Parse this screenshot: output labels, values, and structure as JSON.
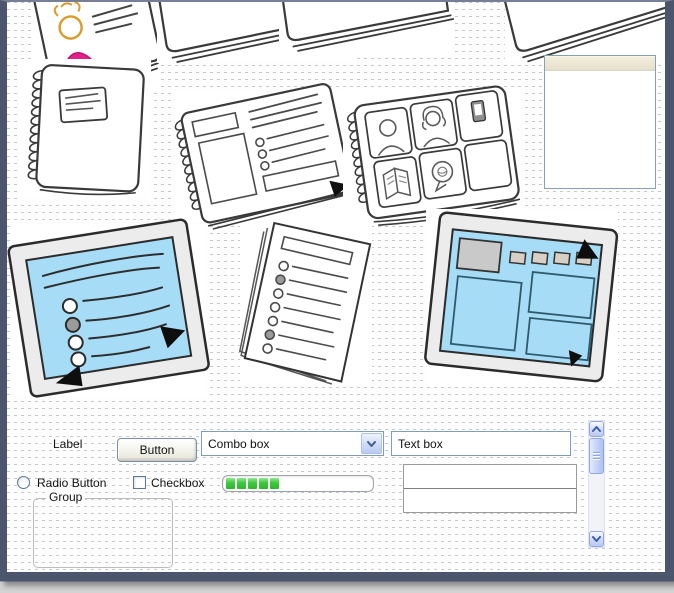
{
  "window": {
    "frame_color": "#4b556b",
    "desktop_color": "#d3d3d3"
  },
  "canvas": {
    "background": "#fdfdfe",
    "grid_dot_color": "#c6c8ce"
  },
  "gallery": {
    "items": [
      {
        "icon": "person-card-sketch"
      },
      {
        "icon": "book-bottom-sketch-1"
      },
      {
        "icon": "book-bottom-sketch-2"
      },
      {
        "icon": "book-bottom-sketch-3"
      },
      {
        "icon": "spiral-notebook-sketch"
      },
      {
        "icon": "wireframe-sketchbook-sketch"
      },
      {
        "icon": "photo-album-sketch"
      },
      {
        "icon": "blank-panel-with-header"
      },
      {
        "icon": "blue-slide-tablet-sketch"
      },
      {
        "icon": "checklist-paper-sketch"
      },
      {
        "icon": "blue-wireframe-tablet-sketch"
      }
    ],
    "sketch_colors": {
      "screen_blue": "#a6dcf5",
      "frame_gray": "#ececec",
      "accent_magenta": "#e0218a",
      "accent_orange": "#d89c2a",
      "panel_header_tan": "#e9e4d0",
      "ink": "#2e2e2e"
    }
  },
  "form": {
    "label_text": "Label",
    "button_label": "Button",
    "combo": {
      "value": "Combo box",
      "icon": "chevron-down-icon"
    },
    "textbox": {
      "value": "Text box"
    },
    "radio": {
      "label": "Radio Button",
      "checked": false
    },
    "checkbox": {
      "label": "Checkbox",
      "checked": false
    },
    "group": {
      "label": "Group"
    },
    "progress": {
      "segments_filled": 5,
      "segment_color": "#3cc93c"
    },
    "table": {
      "rows": 2
    },
    "scrollbar": {
      "orientation": "vertical",
      "icons": [
        "chevron-up-icon",
        "chevron-down-icon"
      ]
    }
  }
}
